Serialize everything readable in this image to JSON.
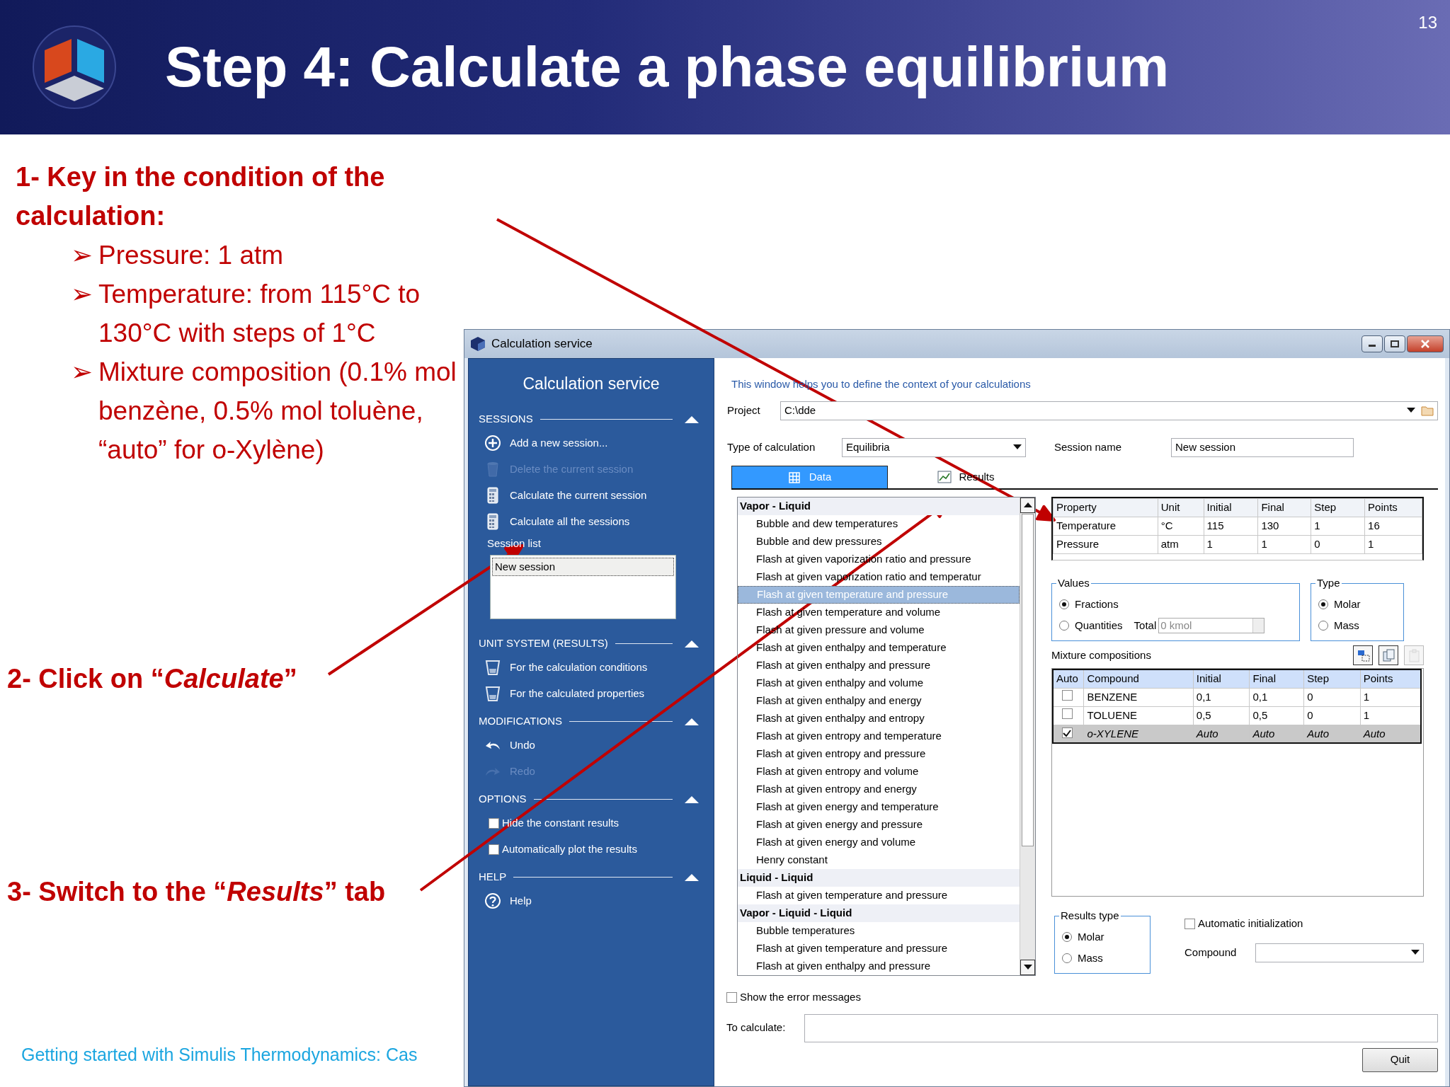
{
  "slide": {
    "title": "Step 4: Calculate a phase equilibrium",
    "page_number": "13"
  },
  "instructions": {
    "heading": "1- Key in the condition of the calculation:",
    "bullets": [
      {
        "marker": "➢",
        "text": "Pressure: 1 atm"
      },
      {
        "marker": "➢",
        "text": "Temperature: from 115°C to 130°C with steps of 1°C"
      },
      {
        "marker": "➢",
        "text": "Mixture composition (0.1% mol  benzène, 0.5% mol toluène, “auto” for o-Xylène)"
      }
    ]
  },
  "step_2": "2- Click on “*Calculate*”",
  "step_3": "3- Switch to the “*Results*” tab",
  "footer": "Getting started with Simulis Thermodynamics: Cas",
  "window": {
    "title": "Calculation service",
    "sidebar": {
      "title": "Calculation service",
      "sections": [
        {
          "header": "SESSIONS",
          "expanded": true,
          "items": [
            {
              "kind": "action",
              "label": "Add a new session...",
              "disabled": false
            },
            {
              "kind": "action",
              "label": "Delete the current session",
              "disabled": true
            },
            {
              "kind": "action",
              "label": "Calculate the current session",
              "disabled": false
            },
            {
              "kind": "action",
              "label": "Calculate all the sessions",
              "disabled": false
            },
            {
              "kind": "list",
              "label": "Session list",
              "entries": [
                {
                  "label": "New session",
                  "selected": true
                }
              ]
            }
          ]
        },
        {
          "header": "UNIT SYSTEM (RESULTS)",
          "expanded": true,
          "items": [
            {
              "kind": "action",
              "label": "For the calculation conditions",
              "disabled": false
            },
            {
              "kind": "action",
              "label": "For the calculated properties",
              "disabled": false
            }
          ]
        },
        {
          "header": "MODIFICATIONS",
          "expanded": true,
          "items": [
            {
              "kind": "action",
              "label": "Undo",
              "disabled": false
            },
            {
              "kind": "action",
              "label": "Redo",
              "disabled": true
            }
          ]
        },
        {
          "header": "OPTIONS",
          "expanded": true,
          "items": [
            {
              "kind": "checkbox",
              "label": "Hide the constant results",
              "checked": false
            },
            {
              "kind": "checkbox",
              "label": "Automatically plot the results",
              "checked": false
            }
          ]
        },
        {
          "header": "HELP",
          "expanded": true,
          "items": [
            {
              "kind": "action",
              "label": "Help",
              "disabled": false
            }
          ]
        }
      ]
    },
    "intro": "This window helps you to define the context of your calculations",
    "project": {
      "label": "Project",
      "value": "C:\\dde"
    },
    "type_of_calculation": {
      "label": "Type of calculation",
      "value": "Equilibria"
    },
    "session_name": {
      "label": "Session name",
      "value": "New session"
    },
    "tabs": [
      {
        "label": "Data",
        "selected": true
      },
      {
        "label": "Results",
        "selected": false
      }
    ],
    "calculation_list": [
      {
        "group": "Vapor - Liquid",
        "items": [
          {
            "label": "Bubble and dew temperatures",
            "selected": false
          },
          {
            "label": "Bubble and dew pressures",
            "selected": false
          },
          {
            "label": "Flash at given vaporization ratio and pressure",
            "selected": false
          },
          {
            "label": "Flash at given vaporization ratio and temperatur",
            "selected": false
          },
          {
            "label": "Flash at given temperature and pressure",
            "selected": true
          },
          {
            "label": "Flash at given temperature and volume",
            "selected": false
          },
          {
            "label": "Flash at given pressure and volume",
            "selected": false
          },
          {
            "label": "Flash at given enthalpy and temperature",
            "selected": false
          },
          {
            "label": "Flash at given enthalpy and pressure",
            "selected": false
          },
          {
            "label": "Flash at given enthalpy and volume",
            "selected": false
          },
          {
            "label": "Flash at given enthalpy and energy",
            "selected": false
          },
          {
            "label": "Flash at given enthalpy and entropy",
            "selected": false
          },
          {
            "label": "Flash at given entropy and temperature",
            "selected": false
          },
          {
            "label": "Flash at given entropy and pressure",
            "selected": false
          },
          {
            "label": "Flash at given entropy and volume",
            "selected": false
          },
          {
            "label": "Flash at given entropy and energy",
            "selected": false
          },
          {
            "label": "Flash at given energy and temperature",
            "selected": false
          },
          {
            "label": "Flash at given energy and pressure",
            "selected": false
          },
          {
            "label": "Flash at given energy and volume",
            "selected": false
          },
          {
            "label": "Henry constant",
            "selected": false
          }
        ]
      },
      {
        "group": "Liquid - Liquid",
        "items": [
          {
            "label": "Flash at given temperature and pressure",
            "selected": false
          }
        ]
      },
      {
        "group": "Vapor - Liquid - Liquid",
        "items": [
          {
            "label": "Bubble temperatures",
            "selected": false
          },
          {
            "label": "Flash at given temperature and pressure",
            "selected": false
          },
          {
            "label": "Flash at given enthalpy and pressure",
            "selected": false
          }
        ]
      }
    ],
    "conditions_table": {
      "columns": [
        "Property",
        "Unit",
        "Initial",
        "Final",
        "Step",
        "Points"
      ],
      "rows": [
        [
          "Temperature",
          "°C",
          "115",
          "130",
          "1",
          "16"
        ],
        [
          "Pressure",
          "atm",
          "1",
          "1",
          "0",
          "1"
        ]
      ]
    },
    "values": {
      "title": "Values",
      "options": [
        {
          "label": "Fractions",
          "selected": true
        },
        {
          "label": "Quantities",
          "selected": false
        }
      ],
      "total_label": "Total",
      "total_value": "0 kmol"
    },
    "type": {
      "title": "Type",
      "options": [
        {
          "label": "Molar",
          "selected": true
        },
        {
          "label": "Mass",
          "selected": false
        }
      ]
    },
    "mixture": {
      "label": "Mixture compositions",
      "toolbar": [
        {
          "disabled": false
        },
        {
          "disabled": false
        },
        {
          "disabled": true
        }
      ],
      "auto_header": "Auto",
      "columns": [
        "Compound",
        "Initial",
        "Final",
        "Step",
        "Points"
      ],
      "rows": [
        {
          "auto": false,
          "cells": [
            "BENZENE",
            "0,1",
            "0,1",
            "0",
            "1"
          ]
        },
        {
          "auto": false,
          "cells": [
            "TOLUENE",
            "0,5",
            "0,5",
            "0",
            "1"
          ]
        },
        {
          "auto": true,
          "cells": [
            "o-XYLENE",
            "Auto",
            "Auto",
            "Auto",
            "Auto"
          ]
        }
      ]
    },
    "results_type": {
      "title": "Results type",
      "options": [
        {
          "label": "Molar",
          "selected": true
        },
        {
          "label": "Mass",
          "selected": false
        }
      ]
    },
    "automatic_initialization": {
      "label": "Automatic initialization",
      "checked": false
    },
    "compound": {
      "label": "Compound"
    },
    "show_errors": {
      "label": "Show the error messages",
      "checked": false
    },
    "to_calculate": {
      "label": "To calculate:"
    },
    "quit": "Quit"
  }
}
